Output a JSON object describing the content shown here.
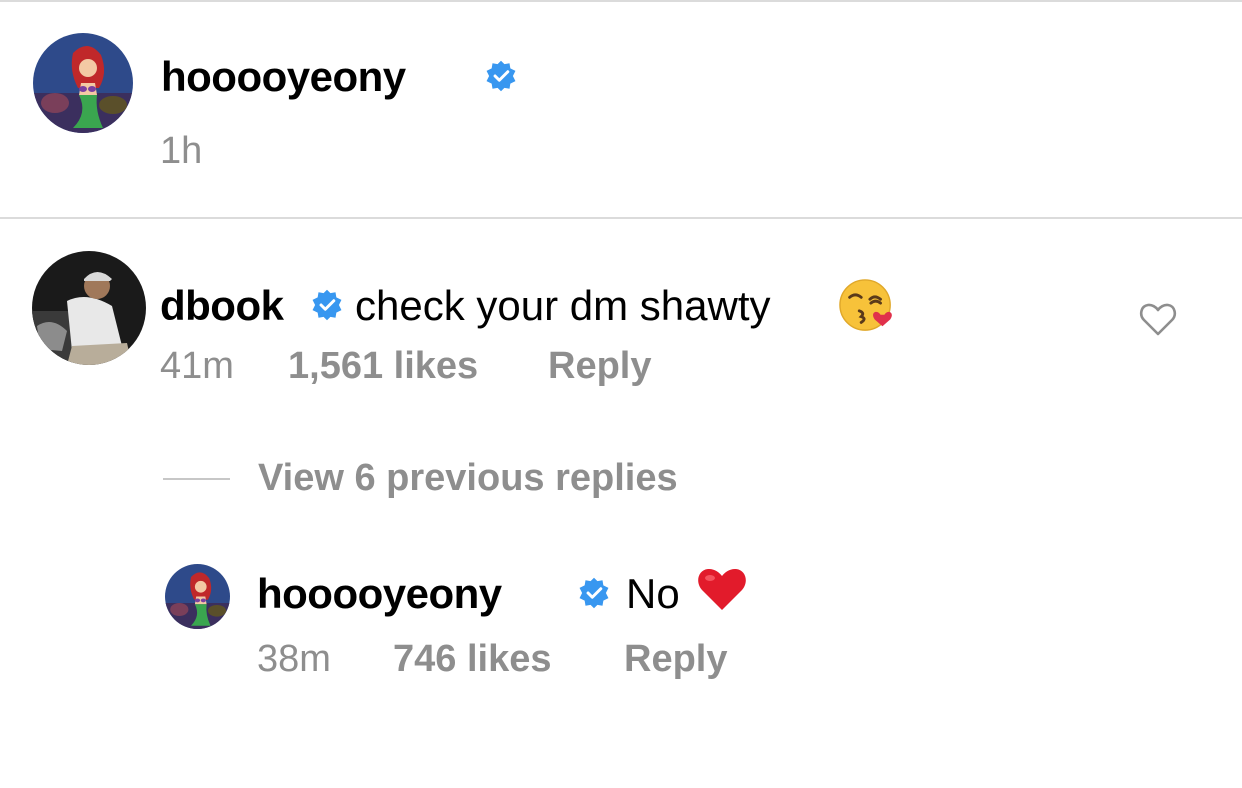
{
  "post": {
    "author": "hooooyeony",
    "time": "1h"
  },
  "comment": {
    "author": "dbook",
    "text": "check your dm shawty",
    "emoji": "kissing-face-with-heart-emoji",
    "time": "41m",
    "likes": "1,561 likes",
    "reply_label": "Reply"
  },
  "view_replies": "View 6 previous replies",
  "reply": {
    "author": "hooooyeony",
    "text": "No",
    "emoji": "red-heart-emoji",
    "time": "38m",
    "likes": "746 likes",
    "reply_label": "Reply"
  },
  "colors": {
    "verified": "#3897f0",
    "meta": "#8e8e8e",
    "divider": "#dbdbdb"
  }
}
